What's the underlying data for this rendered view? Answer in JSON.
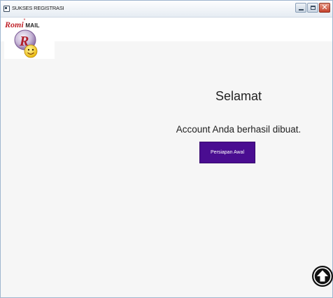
{
  "window": {
    "title": "SUKSES REGISTRASI"
  },
  "logo": {
    "brand": "Romi",
    "star": "*",
    "product": "MAIL"
  },
  "content": {
    "greeting": "Selamat",
    "message": "Account Anda berhasil dibuat.",
    "primary_button_label": "Persiapan Awal"
  },
  "icons": {
    "window_icon": "window-icon",
    "minimize": "minimize-icon",
    "maximize": "maximize-icon",
    "close": "close-icon",
    "scroll_top": "arrow-up-circle-icon"
  },
  "colors": {
    "accent": "#4a0d91",
    "background": "#f6f6f6",
    "brand_red": "#c0242b"
  }
}
